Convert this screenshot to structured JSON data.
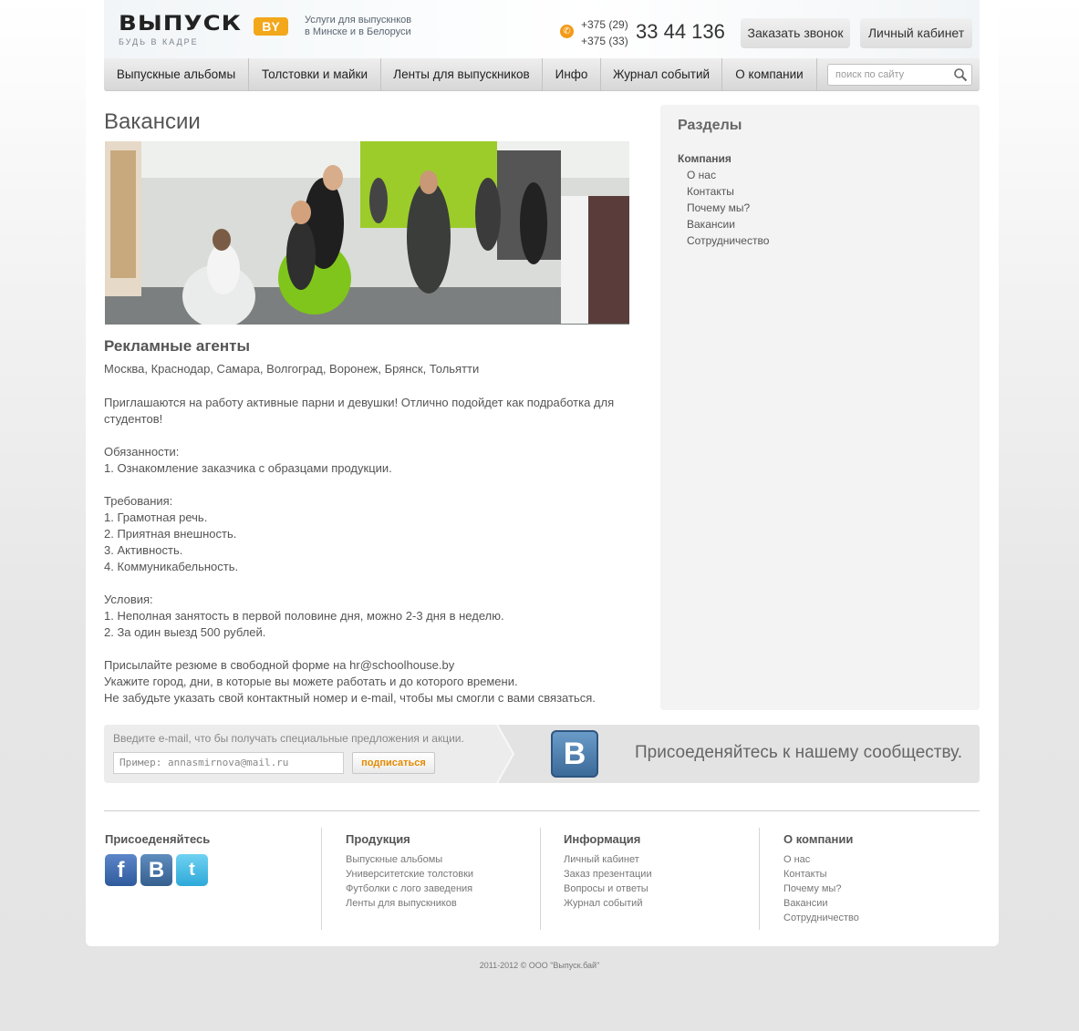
{
  "header": {
    "logo_text": "ВЫПУСК",
    "logo_badge": "BY",
    "logo_tagline": "БУДЬ В КАДРЕ",
    "services_line1": "Услуги для выпускнков",
    "services_line2": "в Минске и в Белоруси",
    "phone_code_1": "+375 (29)",
    "phone_code_2": "+375 (33)",
    "phone_number": "33 44 136",
    "call_button": "Заказать звонок",
    "cabinet_button": "Личный кабинет"
  },
  "nav": {
    "items": [
      {
        "label": "Выпускные альбомы"
      },
      {
        "label": "Толстовки и майки"
      },
      {
        "label": "Ленты для выпускников"
      },
      {
        "label": "Инфо"
      },
      {
        "label": "Журнал событий"
      },
      {
        "label": "О компании"
      }
    ],
    "search_placeholder": "поиск по сайту"
  },
  "main": {
    "title": "Вакансии",
    "job_title": "Рекламные агенты",
    "cities": "Москва, Краснодар, Самара, Волгоград, Воронеж, Брянск, Тольятти",
    "paragraphs": [
      "Приглашаются на работу активные парни и девушки! Отлично подойдет как подработка для студентов!",
      "",
      "Обязанности:",
      "1. Ознакомление заказчика с образцами продукции.",
      "",
      "Требования:",
      "1. Грамотная речь.",
      "2. Приятная внешность.",
      "3. Активность.",
      "4. Коммуникабельность.",
      "",
      "Условия:",
      "1. Неполная занятость в первой половине дня, можно 2-3 дня в неделю.",
      "2. За один выезд 500 рублей.",
      "",
      "Присылайте резюме в свободной форме на hr@schoolhouse.by",
      "Укажите город, дни, в которые вы можете работать и до которого времени.",
      "Не забудьте указать свой контактный номер и e-mail, чтобы мы смогли с вами связаться."
    ]
  },
  "sidebar": {
    "title": "Разделы",
    "group": "Компания",
    "items": [
      {
        "label": "О нас"
      },
      {
        "label": "Контакты"
      },
      {
        "label": "Почему мы?"
      },
      {
        "label": "Вакансии"
      },
      {
        "label": "Сотрудничество"
      }
    ]
  },
  "subscribe": {
    "label": "Введите e-mail, что бы получать специальные предложения и акции.",
    "placeholder": "Пример: annasmirnova@mail.ru",
    "button": "подписаться",
    "vk_letter": "B",
    "join_text": "Присоеденяйтесь к нашему сообществу."
  },
  "footer": {
    "join_title": "Присоеденяйтесь",
    "social": [
      {
        "icon": "facebook-icon",
        "glyph": "f"
      },
      {
        "icon": "vk-icon",
        "glyph": "B"
      },
      {
        "icon": "twitter-icon",
        "glyph": "t"
      }
    ],
    "products_title": "Продукция",
    "products": [
      {
        "label": "Выпускные альбомы"
      },
      {
        "label": "Университетские толстовки"
      },
      {
        "label": "Футболки с лого заведения"
      },
      {
        "label": "Ленты для выпускников"
      }
    ],
    "info_title": "Информация",
    "info": [
      {
        "label": "Личный кабинет"
      },
      {
        "label": "Заказ презентации"
      },
      {
        "label": "Вопросы и ответы"
      },
      {
        "label": "Журнал событий"
      }
    ],
    "company_title": "О компании",
    "company": [
      {
        "label": "О нас"
      },
      {
        "label": "Контакты"
      },
      {
        "label": "Почему мы?"
      },
      {
        "label": "Вакансии"
      },
      {
        "label": "Сотрудничество"
      }
    ],
    "copyright": "2011-2012  ©  ООО \"Выпуск.бай\""
  },
  "colors": {
    "accent": "#f3a71b",
    "subscribe_button_text": "#e38b00",
    "vk_blue": "#3c6a99"
  }
}
